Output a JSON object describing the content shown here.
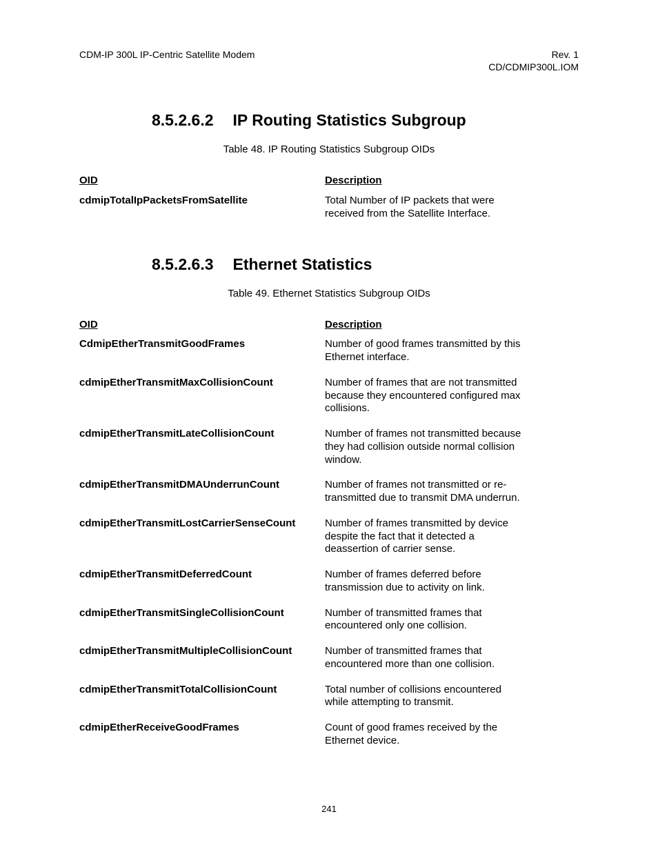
{
  "header": {
    "left": "CDM-IP 300L IP-Centric Satellite Modem",
    "right1": "Rev. 1",
    "right2": "CD/CDMIP300L.IOM"
  },
  "section1": {
    "num": "8.5.2.6.2",
    "title": "IP Routing Statistics Subgroup",
    "caption": "Table 48. IP Routing Statistics Subgroup OIDs",
    "th_oid": "OID",
    "th_desc": "Description",
    "rows": [
      {
        "oid": "cdmipTotalIpPacketsFromSatellite",
        "desc": "Total Number of IP packets that were received from the Satellite Interface."
      }
    ]
  },
  "section2": {
    "num": "8.5.2.6.3",
    "title": "Ethernet Statistics",
    "caption": "Table 49. Ethernet Statistics Subgroup OIDs",
    "th_oid": "OID",
    "th_desc": "Description",
    "rows": [
      {
        "oid": "CdmipEtherTransmitGoodFrames",
        "desc": "Number of good frames transmitted by this Ethernet interface."
      },
      {
        "oid": "cdmipEtherTransmitMaxCollisionCount",
        "desc": "Number of frames that are not transmitted because they encountered configured max collisions."
      },
      {
        "oid": "cdmipEtherTransmitLateCollisionCount",
        "desc": "Number of frames not transmitted because they had collision outside normal collision window."
      },
      {
        "oid": "cdmipEtherTransmitDMAUnderrunCount",
        "desc": "Number of frames not transmitted or re-transmitted due to transmit DMA underrun."
      },
      {
        "oid": "cdmipEtherTransmitLostCarrierSenseCount",
        "desc": "Number of frames transmitted by device despite the fact that it detected a deassertion of carrier sense."
      },
      {
        "oid": "cdmipEtherTransmitDeferredCount",
        "desc": "Number of frames deferred before transmission due to activity on link."
      },
      {
        "oid": "cdmipEtherTransmitSingleCollisionCount",
        "desc": "Number of transmitted frames that encountered only one collision."
      },
      {
        "oid": "cdmipEtherTransmitMultipleCollisionCount",
        "desc": "Number of transmitted frames that encountered more than one collision."
      },
      {
        "oid": "cdmipEtherTransmitTotalCollisionCount",
        "desc": "Total number of collisions encountered while attempting to transmit."
      },
      {
        "oid": "cdmipEtherReceiveGoodFrames",
        "desc": "Count of good frames received by the Ethernet device."
      }
    ]
  },
  "footer": {
    "page": "241"
  }
}
